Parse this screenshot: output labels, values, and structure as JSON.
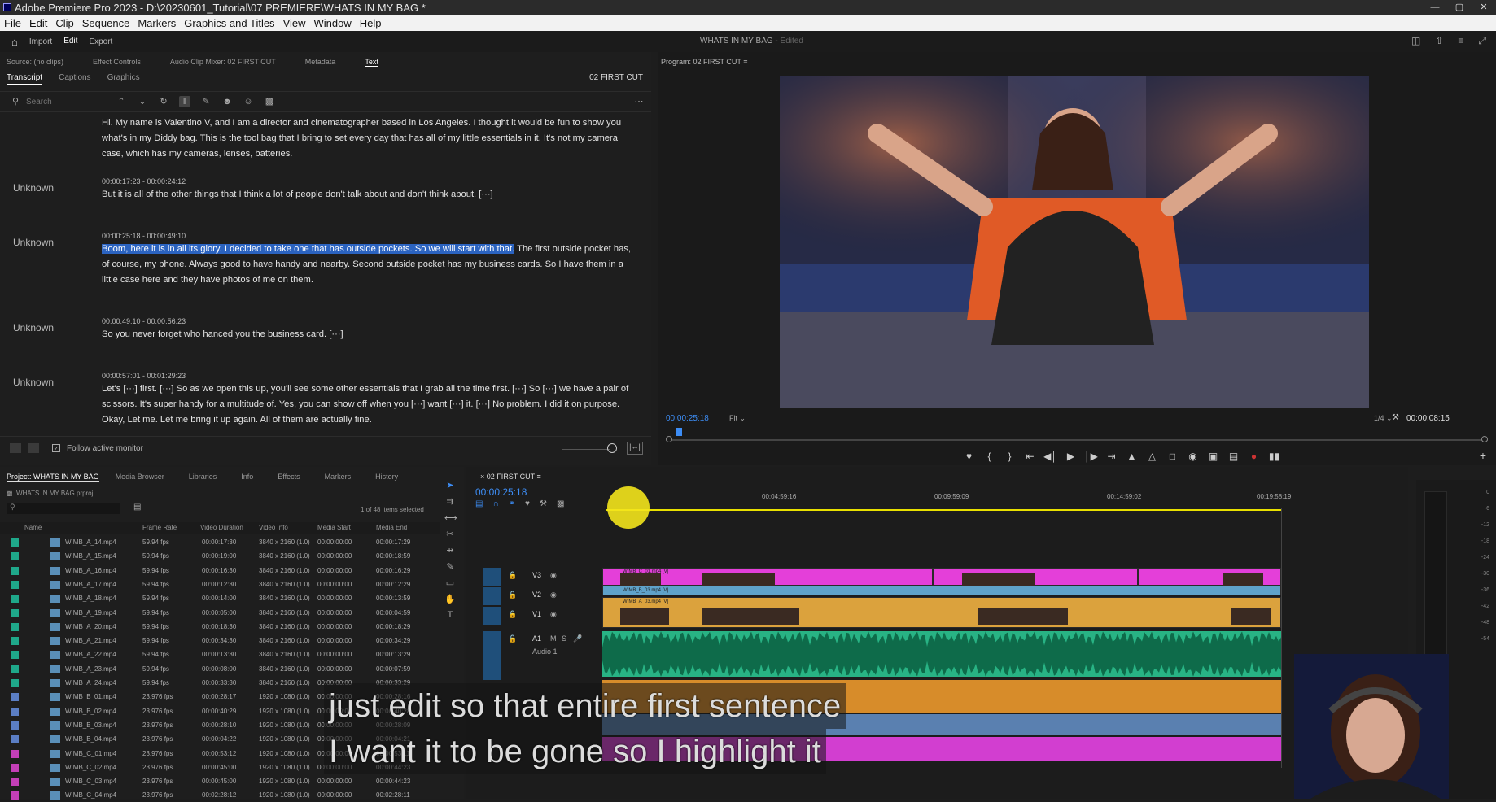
{
  "app": {
    "title": "Adobe Premiere Pro 2023 - D:\\20230601_Tutorial\\07 PREMIERE\\WHATS IN MY BAG *"
  },
  "menu": [
    "File",
    "Edit",
    "Clip",
    "Sequence",
    "Markers",
    "Graphics and Titles",
    "View",
    "Window",
    "Help"
  ],
  "workspace": {
    "tabs": [
      "Import",
      "Edit",
      "Export"
    ],
    "active": "Edit",
    "project_title": "WHATS IN MY BAG",
    "status": "- Edited"
  },
  "source_panel": {
    "tabs": [
      "Source: (no clips)",
      "Effect Controls",
      "Audio Clip Mixer: 02 FIRST CUT",
      "Metadata",
      "Text"
    ],
    "subtabs": [
      "Transcript",
      "Captions",
      "Graphics"
    ],
    "sequence": "02 FIRST CUT",
    "search_placeholder": "Search",
    "follow_label": "Follow active monitor"
  },
  "transcript": [
    {
      "speaker": "",
      "timecode": "",
      "text": "Hi. My name is Valentino V, and I am a director and cinematographer based in Los Angeles. I thought it would be fun to show you what's in my Diddy bag. This is the tool bag that I bring to set every day that has all of my little essentials in it. It's not my camera case, which has my cameras, lenses, batteries."
    },
    {
      "speaker": "Unknown",
      "timecode": "00:00:17:23 - 00:00:24:12",
      "text": "But it is all of the other things that I think a lot of people don't talk about and don't think about. [···]"
    },
    {
      "speaker": "Unknown",
      "timecode": "00:00:25:18 - 00:00:49:10",
      "highlight": "Boom, here it is in all its glory. I decided to take one that has outside pockets. So we will start with that.",
      "text": " The first outside pocket has, of course, my phone. Always good to have handy and nearby. Second outside pocket has my business cards. So I have them in a little case here and they have photos of me on them."
    },
    {
      "speaker": "Unknown",
      "timecode": "00:00:49:10 - 00:00:56:23",
      "text": "So you never forget who hanced you the business card. [···]"
    },
    {
      "speaker": "Unknown",
      "timecode": "00:00:57:01 - 00:01:29:23",
      "text": "Let's [···] first. [···] So as we open this up, you'll see some other essentials that I grab all the time first. [···] So [···] we have a pair of scissors. It's super handy for a multitude of. Yes, you can show off when you [···] want [···] it. [···] No problem. I did it on purpose. Okay, Let me. Let me bring it up again. All of them are actually fine."
    }
  ],
  "program": {
    "title": "Program: 02 FIRST CUT",
    "timecode": "00:00:25:18",
    "fit": "Fit",
    "quality": "1/4",
    "duration": "00:00:08:15"
  },
  "project": {
    "tabs": [
      "Project: WHATS IN MY BAG",
      "Media Browser",
      "Libraries",
      "Info",
      "Effects",
      "Markers",
      "History"
    ],
    "file": "WHATS IN MY BAG.prproj",
    "item_count": "1 of 48 items selected",
    "columns": [
      "Name",
      "Frame Rate",
      "Video Duration",
      "Video Info",
      "Media Start",
      "Media End"
    ],
    "rows": [
      {
        "name": "WIMB_A_14.mp4",
        "fps": "59.94 fps",
        "dur": "00:00:17:30",
        "info": "3840 x 2160 (1.0)",
        "start": "00:00:00:00",
        "end": "00:00:17:29",
        "color": "#1fa88a"
      },
      {
        "name": "WIMB_A_15.mp4",
        "fps": "59.94 fps",
        "dur": "00:00:19:00",
        "info": "3840 x 2160 (1.0)",
        "start": "00:00:00:00",
        "end": "00:00:18:59",
        "color": "#1fa88a"
      },
      {
        "name": "WIMB_A_16.mp4",
        "fps": "59.94 fps",
        "dur": "00:00:16:30",
        "info": "3840 x 2160 (1.0)",
        "start": "00:00:00:00",
        "end": "00:00:16:29",
        "color": "#1fa88a"
      },
      {
        "name": "WIMB_A_17.mp4",
        "fps": "59.94 fps",
        "dur": "00:00:12:30",
        "info": "3840 x 2160 (1.0)",
        "start": "00:00:00:00",
        "end": "00:00:12:29",
        "color": "#1fa88a"
      },
      {
        "name": "WIMB_A_18.mp4",
        "fps": "59.94 fps",
        "dur": "00:00:14:00",
        "info": "3840 x 2160 (1.0)",
        "start": "00:00:00:00",
        "end": "00:00:13:59",
        "color": "#1fa88a"
      },
      {
        "name": "WIMB_A_19.mp4",
        "fps": "59.94 fps",
        "dur": "00:00:05:00",
        "info": "3840 x 2160 (1.0)",
        "start": "00:00:00:00",
        "end": "00:00:04:59",
        "color": "#1fa88a"
      },
      {
        "name": "WIMB_A_20.mp4",
        "fps": "59.94 fps",
        "dur": "00:00:18:30",
        "info": "3840 x 2160 (1.0)",
        "start": "00:00:00:00",
        "end": "00:00:18:29",
        "color": "#1fa88a"
      },
      {
        "name": "WIMB_A_21.mp4",
        "fps": "59.94 fps",
        "dur": "00:00:34:30",
        "info": "3840 x 2160 (1.0)",
        "start": "00:00:00:00",
        "end": "00:00:34:29",
        "color": "#1fa88a"
      },
      {
        "name": "WIMB_A_22.mp4",
        "fps": "59.94 fps",
        "dur": "00:00:13:30",
        "info": "3840 x 2160 (1.0)",
        "start": "00:00:00:00",
        "end": "00:00:13:29",
        "color": "#1fa88a"
      },
      {
        "name": "WIMB_A_23.mp4",
        "fps": "59.94 fps",
        "dur": "00:00:08:00",
        "info": "3840 x 2160 (1.0)",
        "start": "00:00:00:00",
        "end": "00:00:07:59",
        "color": "#1fa88a"
      },
      {
        "name": "WIMB_A_24.mp4",
        "fps": "59.94 fps",
        "dur": "00:00:33:30",
        "info": "3840 x 2160 (1.0)",
        "start": "00:00:00:00",
        "end": "00:00:33:29",
        "color": "#1fa88a"
      },
      {
        "name": "WIMB_B_01.mp4",
        "fps": "23.976 fps",
        "dur": "00:00:28:17",
        "info": "1920 x 1080 (1.0)",
        "start": "00:00:00:00",
        "end": "00:00:28:16",
        "color": "#5b7ec4"
      },
      {
        "name": "WIMB_B_02.mp4",
        "fps": "23.976 fps",
        "dur": "00:00:40:29",
        "info": "1920 x 1080 (1.0)",
        "start": "00:00:00:00",
        "end": "00:00:40:28",
        "color": "#5b7ec4"
      },
      {
        "name": "WIMB_B_03.mp4",
        "fps": "23.976 fps",
        "dur": "00:00:28:10",
        "info": "1920 x 1080 (1.0)",
        "start": "00:00:00:00",
        "end": "00:00:28:09",
        "color": "#5b7ec4"
      },
      {
        "name": "WIMB_B_04.mp4",
        "fps": "23.976 fps",
        "dur": "00:00:04:22",
        "info": "1920 x 1080 (1.0)",
        "start": "00:00:00:00",
        "end": "00:00:04:21",
        "color": "#5b7ec4"
      },
      {
        "name": "WIMB_C_01.mp4",
        "fps": "23.976 fps",
        "dur": "00:00:53:12",
        "info": "1920 x 1080 (1.0)",
        "start": "00:00:00:00",
        "end": "00:00:53:11",
        "color": "#c43fb8"
      },
      {
        "name": "WIMB_C_02.mp4",
        "fps": "23.976 fps",
        "dur": "00:00:45:00",
        "info": "1920 x 1080 (1.0)",
        "start": "00:00:00:00",
        "end": "00:00:44:23",
        "color": "#c43fb8"
      },
      {
        "name": "WIMB_C_03.mp4",
        "fps": "23.976 fps",
        "dur": "00:00:45:00",
        "info": "1920 x 1080 (1.0)",
        "start": "00:00:00:00",
        "end": "00:00:44:23",
        "color": "#c43fb8"
      },
      {
        "name": "WIMB_C_04.mp4",
        "fps": "23.976 fps",
        "dur": "00:02:28:12",
        "info": "1920 x 1080 (1.0)",
        "start": "00:00:00:00",
        "end": "00:02:28:11",
        "color": "#c43fb8"
      }
    ]
  },
  "timeline": {
    "tab": "02 FIRST CUT",
    "timecode": "00:00:25:18",
    "ruler": [
      "00:04:59:16",
      "00:09:59:09",
      "00:14:59:02",
      "00:19:58:19"
    ],
    "tracks": [
      "V3",
      "V2",
      "V1",
      "A1"
    ],
    "audio_label": "Audio 1",
    "clip_v3": "WIMB_C_01.mp4 [V]",
    "clip_v2": "WIMB_B_03.mp4 [V]",
    "clip_v1": "WIMB_A_03.mp4 [V]"
  },
  "subtitle": {
    "line1": "just edit so that entire first sentence",
    "line2": "I want it to be gone so I highlight it"
  },
  "meters": [
    "0",
    "-6",
    "-12",
    "-18",
    "-24",
    "-30",
    "-36",
    "-42",
    "-48",
    "-54"
  ],
  "colors": {
    "highlight": "#2b63c0",
    "timecode": "#3d8df5",
    "v3_clip": "#e43fd9",
    "v1_clip": "#dba23d",
    "audio_clip": "#28b384"
  }
}
